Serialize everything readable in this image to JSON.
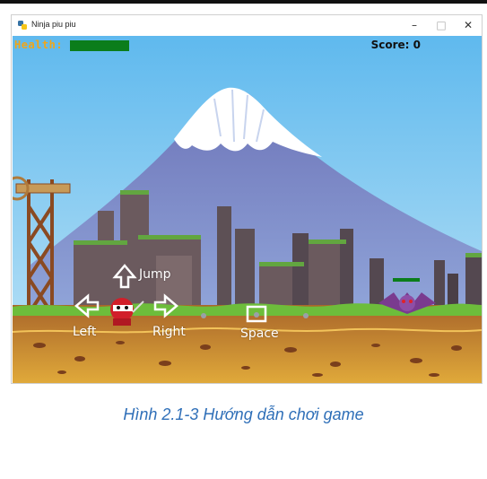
{
  "window": {
    "title": "Ninja piu piu",
    "minimize_glyph": "–",
    "maximize_glyph": "□",
    "close_glyph": "✕"
  },
  "hud": {
    "health_label": "Health:",
    "health_fraction": 1.0,
    "score_text": "Score: 0"
  },
  "controls": {
    "jump": "Jump",
    "left": "Left",
    "right": "Right",
    "space": "Space"
  },
  "caption": "Hình 2.1-3 Hướng dẫn chơi game",
  "colors": {
    "sky": "#7fc9f1",
    "ground": "#c0862f",
    "grass": "#6dbd3b",
    "hud_health": "#f0a61a",
    "health_bar": "#0b7d1b",
    "caption": "#2f6fb8"
  }
}
